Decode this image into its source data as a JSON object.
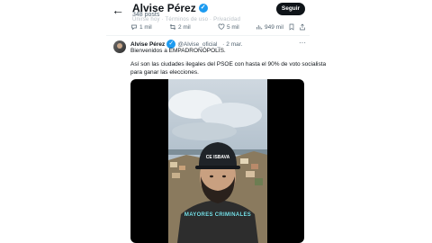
{
  "header": {
    "profile_name": "Alvise Pérez",
    "post_count": "348 posts",
    "follow_label": "Seguir",
    "ghost_text": "Unirse hoy  · Términos de uso · Privacidad"
  },
  "top_actions": {
    "reply": "1 mil",
    "repost": "2 mil",
    "like": "5 mil",
    "views": "949 mil"
  },
  "tweet": {
    "name": "Alvise Pérez",
    "handle": "@Alvise_oficial_",
    "dot": "·",
    "date": "2 mar.",
    "line1": "Bienvenidos a EMPADRONÓPOLIS.",
    "line2": "Así son las ciudades ilegales del PSOE con hasta el 90% de voto socialista",
    "line3": "para ganar las elecciones.",
    "video": {
      "cap_text": "CE ISBAVA",
      "caption": "MAYORES CRIMINALES"
    }
  },
  "icons": {
    "back": "back-arrow-icon",
    "verified": "verified-badge-icon",
    "reply": "reply-icon",
    "repost": "repost-icon",
    "like": "heart-icon",
    "views": "views-icon",
    "bookmark": "bookmark-icon",
    "share": "share-icon",
    "more": "more-icon"
  },
  "colors": {
    "accent": "#1d9bf0",
    "text": "#0f1419",
    "secondary": "#536471",
    "button_bg": "#0f1419",
    "caption": "#7ee8f0"
  }
}
